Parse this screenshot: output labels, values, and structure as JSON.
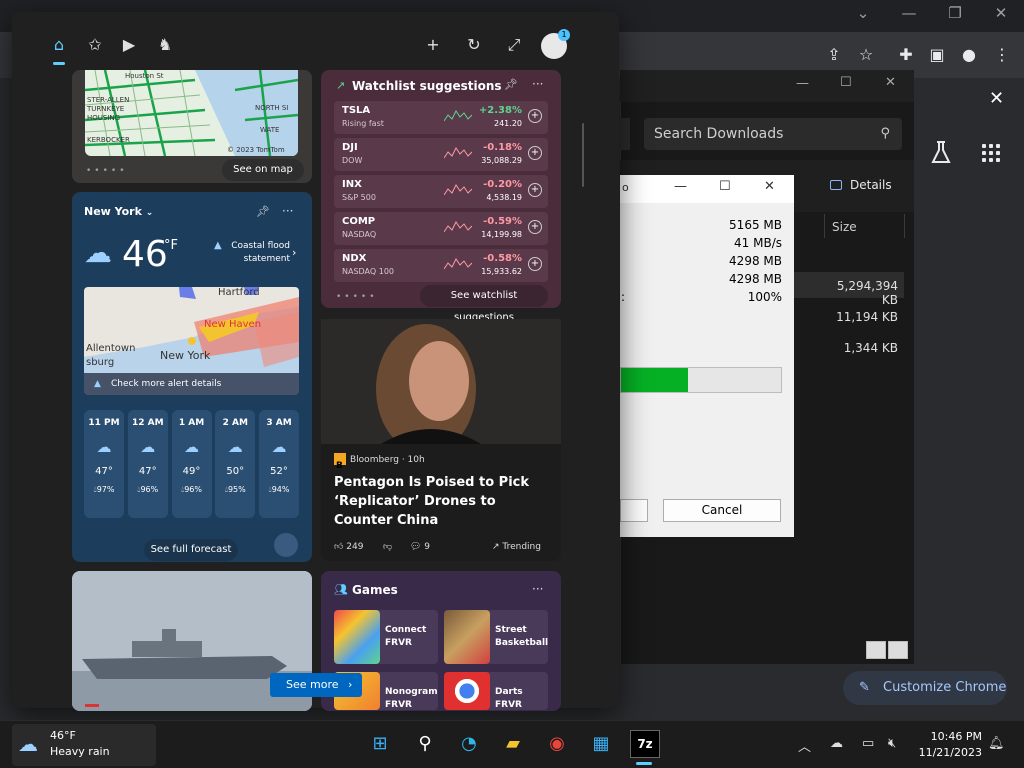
{
  "colors": {
    "accent": "#60cdff",
    "progress": "#06b025",
    "link": "#a8c7fa",
    "up": "#5fd38d",
    "down": "#ff99a4"
  },
  "chrome": {
    "customize_label": "Customize Chrome"
  },
  "explorer": {
    "search_placeholder": "Search Downloads",
    "details_label": "Details",
    "size_header": "Size",
    "sizes": [
      "5,294,394 KB",
      "11,194 KB",
      "1,344 KB"
    ]
  },
  "zip_dialog": {
    "values": [
      "5165 MB",
      "41 MB/s",
      "4298 MB",
      "4298 MB",
      "100%"
    ],
    "colon": ":",
    "progress_fraction": 0.42,
    "cancel_label": "Cancel"
  },
  "map_card": {
    "labels": [
      "Houston St",
      "STER-ALLEN",
      "TURNKEYE",
      "HOUSING",
      "KERBOCKER",
      "NORTH SI",
      "WATE",
      "© 2023 TomTom"
    ],
    "see_on_map": "See on map"
  },
  "watchlist": {
    "title": "Watchlist suggestions",
    "see_label": "See watchlist suggestions",
    "rows": [
      {
        "sym": "TSLA",
        "sub": "Rising fast",
        "chg": "+2.38%",
        "price": "241.20",
        "dir": "up"
      },
      {
        "sym": "DJI",
        "sub": "DOW",
        "chg": "-0.18%",
        "price": "35,088.29",
        "dir": "down"
      },
      {
        "sym": "INX",
        "sub": "S&P 500",
        "chg": "-0.20%",
        "price": "4,538.19",
        "dir": "down"
      },
      {
        "sym": "COMP",
        "sub": "NASDAQ",
        "chg": "-0.59%",
        "price": "14,199.98",
        "dir": "down"
      },
      {
        "sym": "NDX",
        "sub": "NASDAQ 100",
        "chg": "-0.58%",
        "price": "15,933.62",
        "dir": "down"
      }
    ]
  },
  "weather": {
    "location": "New York",
    "temp": "46",
    "unit": "°F",
    "alert": "Coastal flood statement",
    "map_labels": [
      "Hartford",
      "Allentown",
      "sburg",
      "New York",
      "New Haven"
    ],
    "check_alerts": "Check more alert details",
    "hours": [
      {
        "time": "11 PM",
        "temp": "47°",
        "pct": "97%"
      },
      {
        "time": "12 AM",
        "temp": "47°",
        "pct": "96%"
      },
      {
        "time": "1 AM",
        "temp": "49°",
        "pct": "96%"
      },
      {
        "time": "2 AM",
        "temp": "50°",
        "pct": "95%"
      },
      {
        "time": "3 AM",
        "temp": "52°",
        "pct": "94%"
      }
    ],
    "forecast_label": "See full forecast"
  },
  "news": {
    "source": "Bloomberg · 10h",
    "logo_letter": "B",
    "headline": "Pentagon Is Poised to Pick ‘Replicator’ Drones to Counter China",
    "likes": "249",
    "comments": "9",
    "trending": "Trending"
  },
  "games": {
    "title": "Games",
    "items": [
      "Connect FRVR",
      "Street Basketball",
      "Nonogram FRVR",
      "Darts FRVR"
    ]
  },
  "see_more": "See more",
  "avatar_badge": "1",
  "taskbar": {
    "temp": "46°F",
    "condition": "Heavy rain",
    "time": "10:46 PM",
    "date": "11/21/2023",
    "zip_label": "7z"
  }
}
